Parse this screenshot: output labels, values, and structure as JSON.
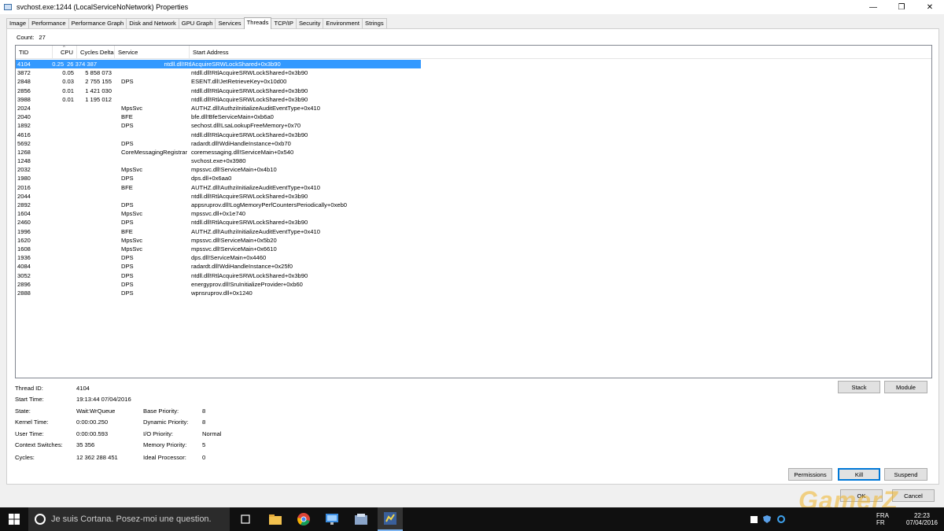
{
  "window": {
    "title": "svchost.exe:1244 (LocalServiceNoNetwork) Properties",
    "minimize": "—",
    "maximize": "❐",
    "close": "✕"
  },
  "tabs": [
    "Image",
    "Performance",
    "Performance Graph",
    "Disk and Network",
    "GPU Graph",
    "Services",
    "Threads",
    "TCP/IP",
    "Security",
    "Environment",
    "Strings"
  ],
  "active_tab": "Threads",
  "count": {
    "label": "Count:",
    "value": "27"
  },
  "threads": {
    "columns": [
      "TID",
      "CPU",
      "Cycles Delta",
      "Service",
      "Start Address"
    ],
    "rows": [
      [
        "4104",
        "0.25",
        "26 374 387",
        "",
        "ntdll.dll!RtlAcquireSRWLockShared+0x3b90"
      ],
      [
        "3872",
        "0.05",
        "5 858 073",
        "",
        "ntdll.dll!RtlAcquireSRWLockShared+0x3b90"
      ],
      [
        "2848",
        "0.03",
        "2 755 155",
        "DPS",
        "ESENT.dll!JetRetrieveKey+0x10d00"
      ],
      [
        "2856",
        "0.01",
        "1 421 030",
        "",
        "ntdll.dll!RtlAcquireSRWLockShared+0x3b90"
      ],
      [
        "3988",
        "0.01",
        "1 195 012",
        "",
        "ntdll.dll!RtlAcquireSRWLockShared+0x3b90"
      ],
      [
        "2024",
        "",
        "",
        "MpsSvc",
        "AUTHZ.dll!AuthziInitializeAuditEventType+0x410"
      ],
      [
        "2040",
        "",
        "",
        "BFE",
        "bfe.dll!BfeServiceMain+0xb6a0"
      ],
      [
        "1892",
        "",
        "",
        "DPS",
        "sechost.dll!LsaLookupFreeMemory+0x70"
      ],
      [
        "4616",
        "",
        "",
        "",
        "ntdll.dll!RtlAcquireSRWLockShared+0x3b90"
      ],
      [
        "5692",
        "",
        "",
        "DPS",
        "radardt.dll!WdiHandleInstance+0xb70"
      ],
      [
        "1268",
        "",
        "",
        "CoreMessagingRegistrar",
        "coremessaging.dll!ServiceMain+0x540"
      ],
      [
        "1248",
        "",
        "",
        "",
        "svchost.exe+0x3980"
      ],
      [
        "2032",
        "",
        "",
        "MpsSvc",
        "mpssvc.dll!ServiceMain+0x4b10"
      ],
      [
        "1980",
        "",
        "",
        "DPS",
        "dps.dll+0x6aa0"
      ],
      [
        "2016",
        "",
        "",
        "BFE",
        "AUTHZ.dll!AuthziInitializeAuditEventType+0x410"
      ],
      [
        "2044",
        "",
        "",
        "",
        "ntdll.dll!RtlAcquireSRWLockShared+0x3b90"
      ],
      [
        "2892",
        "",
        "",
        "DPS",
        "appsruprov.dll!LogMemoryPerfCountersPeriodically+0xeb0"
      ],
      [
        "1604",
        "",
        "",
        "MpsSvc",
        "mpssvc.dll+0x1e740"
      ],
      [
        "2460",
        "",
        "",
        "DPS",
        "ntdll.dll!RtlAcquireSRWLockShared+0x3b90"
      ],
      [
        "1996",
        "",
        "",
        "BFE",
        "AUTHZ.dll!AuthziInitializeAuditEventType+0x410"
      ],
      [
        "1620",
        "",
        "",
        "MpsSvc",
        "mpssvc.dll!ServiceMain+0x5b20"
      ],
      [
        "1608",
        "",
        "",
        "MpsSvc",
        "mpssvc.dll!ServiceMain+0x6610"
      ],
      [
        "1936",
        "",
        "",
        "DPS",
        "dps.dll!ServiceMain+0x4460"
      ],
      [
        "4084",
        "",
        "",
        "DPS",
        "radardt.dll!WdiHandleInstance+0x25f0"
      ],
      [
        "3052",
        "",
        "",
        "DPS",
        "ntdll.dll!RtlAcquireSRWLockShared+0x3b90"
      ],
      [
        "2896",
        "",
        "",
        "DPS",
        "energyprov.dll!SruInitializeProvider+0xb60"
      ],
      [
        "2888",
        "",
        "",
        "DPS",
        "wpnsruprov.dll+0x1240"
      ]
    ]
  },
  "details": {
    "thread_id": {
      "label": "Thread ID:",
      "value": "4104"
    },
    "start_time": {
      "label": "Start Time:",
      "value": "19:13:44   07/04/2016"
    },
    "state": {
      "label": "State:",
      "value": "Wait:WrQueue"
    },
    "kernel_time": {
      "label": "Kernel Time:",
      "value": "0:00:00.250"
    },
    "user_time": {
      "label": "User Time:",
      "value": "0:00:00.593"
    },
    "context_switches": {
      "label": "Context Switches:",
      "value": "35 356"
    },
    "cycles": {
      "label": "Cycles:",
      "value": "12 362 288 451"
    },
    "base_priority": {
      "label": "Base Priority:",
      "value": "8"
    },
    "dynamic_priority": {
      "label": "Dynamic Priority:",
      "value": "8"
    },
    "io_priority": {
      "label": "I/O Priority:",
      "value": "Normal"
    },
    "memory_priority": {
      "label": "Memory Priority:",
      "value": "5"
    },
    "ideal_processor": {
      "label": "Ideal Processor:",
      "value": "0"
    }
  },
  "buttons": {
    "stack": "Stack",
    "module": "Module",
    "permissions": "Permissions",
    "kill": "Kill",
    "suspend": "Suspend",
    "ok": "OK",
    "cancel": "Cancel"
  },
  "taskbar": {
    "cortana_placeholder": "Je suis Cortana. Posez-moi une question.",
    "language": "FRA",
    "locale": "FR",
    "time": "22:23",
    "date": "07/04/2016"
  },
  "watermark": "GamerZ",
  "colors": {
    "selection": "#3399ff",
    "taskbar": "#101010",
    "focus_border": "#0078d7"
  }
}
